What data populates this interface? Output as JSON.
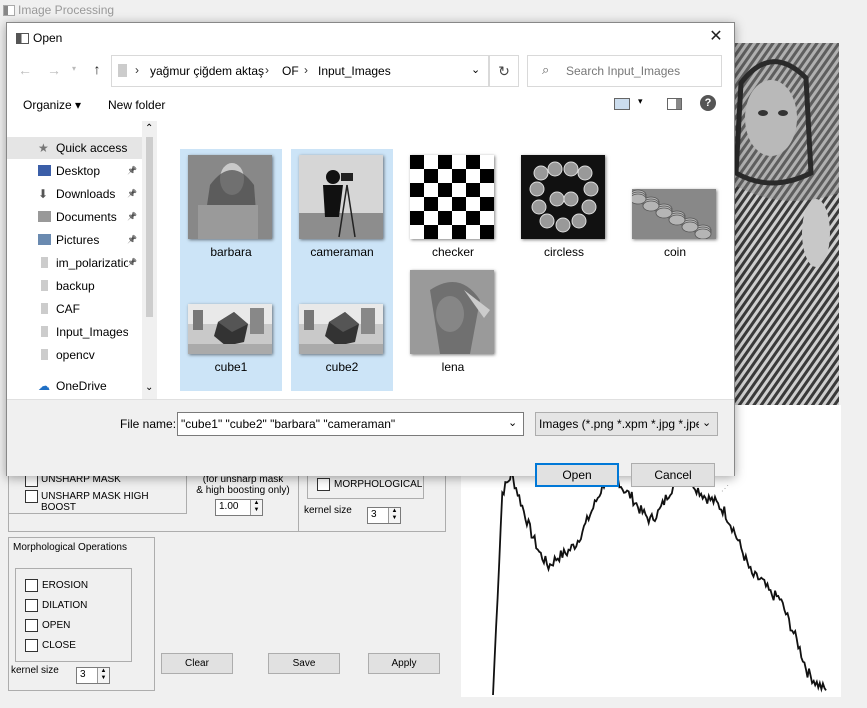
{
  "app": {
    "title": "Image Processing",
    "groups": {
      "unsharp": {
        "unsharp_mask_label": "UNSHARP MASK",
        "unsharp_boost_label": "UNSHARP MASK  HIGH BOOST",
        "note": "(for unsharp mask\n& high boosting only)",
        "boost_value": "1.00"
      },
      "morph_small": {
        "label": "MORPHOLOGICAL",
        "kernel_label": "kernel size",
        "kernel_value": "3"
      },
      "morphological_ops": {
        "title": "Morphological Operations",
        "options": [
          "EROSION",
          "DILATION",
          "OPEN",
          "CLOSE"
        ],
        "kernel_label": "kernel size",
        "kernel_value": "3"
      }
    },
    "buttons": {
      "clear": "Clear",
      "save": "Save",
      "apply": "Apply"
    },
    "histogram_values": [
      0.0,
      0.88,
      0.96,
      0.84,
      0.72,
      0.62,
      0.56,
      0.6,
      0.62,
      0.66,
      0.74,
      0.83,
      0.92,
      0.98,
      0.9,
      0.86,
      0.8,
      0.76,
      0.8,
      0.88,
      0.94,
      0.96,
      0.9,
      0.86,
      0.84,
      0.8,
      0.72,
      0.62,
      0.52,
      0.5,
      0.44,
      0.42,
      0.32,
      0.22,
      0.1,
      0.05,
      0.02
    ]
  },
  "dialog": {
    "title": "Open",
    "close_icon": "close-icon",
    "breadcrumb": [
      "yağmur çiğdem aktaş",
      "OF",
      "Input_Images"
    ],
    "search_placeholder": "Search Input_Images",
    "toolbar": {
      "organize": "Organize ▾",
      "new_folder": "New folder"
    },
    "sidebar": [
      {
        "label": "Quick access",
        "icon": "star-icon",
        "pinned": false,
        "selected": true
      },
      {
        "label": "Desktop",
        "icon": "desktop-icon",
        "pinned": true
      },
      {
        "label": "Downloads",
        "icon": "download-icon",
        "pinned": true
      },
      {
        "label": "Documents",
        "icon": "document-icon",
        "pinned": true
      },
      {
        "label": "Pictures",
        "icon": "pictures-icon",
        "pinned": true
      },
      {
        "label": "im_polarization",
        "icon": "folder-icon",
        "pinned": true
      },
      {
        "label": "backup",
        "icon": "folder-icon",
        "pinned": false
      },
      {
        "label": "CAF",
        "icon": "folder-icon",
        "pinned": false
      },
      {
        "label": "Input_Images",
        "icon": "folder-icon",
        "pinned": false
      },
      {
        "label": "opencv",
        "icon": "folder-icon",
        "pinned": false
      },
      {
        "label": "OneDrive",
        "icon": "cloud-icon",
        "pinned": false
      }
    ],
    "files": [
      {
        "name": "barbara",
        "selected": true,
        "kind": "photo"
      },
      {
        "name": "cameraman",
        "selected": true,
        "kind": "photo"
      },
      {
        "name": "checker",
        "selected": false,
        "kind": "checker"
      },
      {
        "name": "circless",
        "selected": false,
        "kind": "coins"
      },
      {
        "name": "coin",
        "selected": false,
        "kind": "coinpile"
      },
      {
        "name": "cube1",
        "selected": true,
        "kind": "cube"
      },
      {
        "name": "cube2",
        "selected": true,
        "kind": "cube"
      },
      {
        "name": "lena",
        "selected": false,
        "kind": "photo"
      }
    ],
    "file_name_label": "File name:",
    "file_name_value": "\"cube1\" \"cube2\" \"barbara\" \"cameraman\"",
    "file_type": "Images (*.png *.xpm *.jpg *.jpeg",
    "open_button": "Open",
    "cancel_button": "Cancel"
  }
}
